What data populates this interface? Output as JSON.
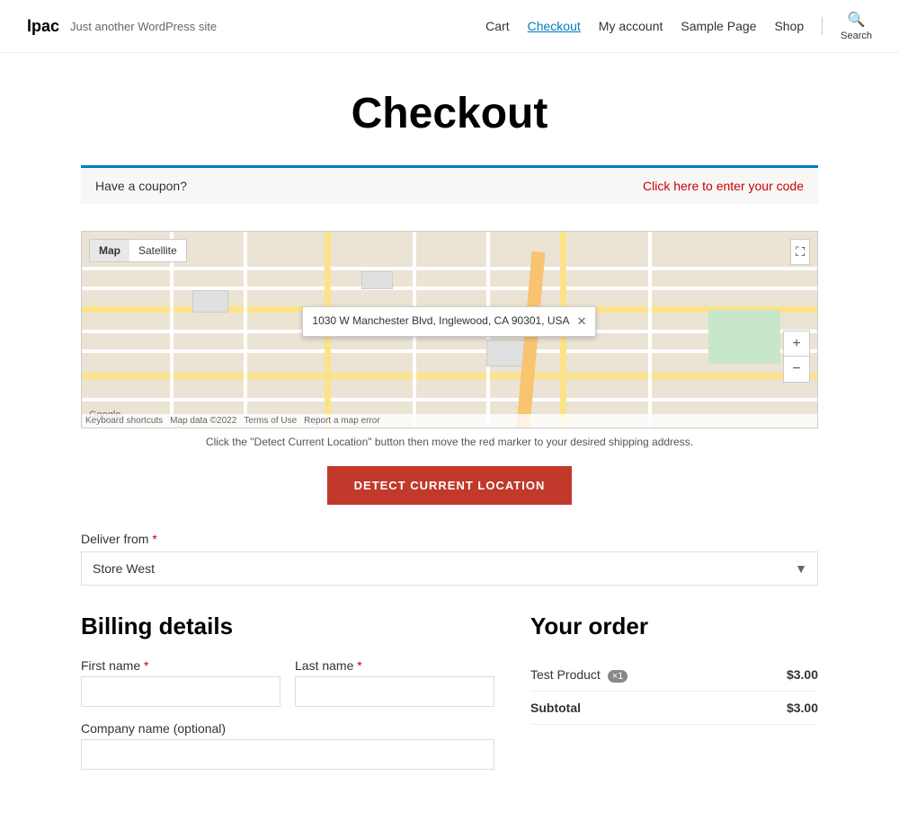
{
  "header": {
    "site_title": "lpac",
    "site_tagline": "Just another WordPress site",
    "nav": [
      {
        "label": "Cart",
        "active": false
      },
      {
        "label": "Checkout",
        "active": true
      },
      {
        "label": "My account",
        "active": false
      },
      {
        "label": "Sample Page",
        "active": false
      },
      {
        "label": "Shop",
        "active": false
      }
    ],
    "search_label": "Search"
  },
  "page": {
    "title": "Checkout"
  },
  "coupon": {
    "text": "Have a coupon?",
    "link_text": "Click here to enter your code"
  },
  "map": {
    "tabs": [
      "Map",
      "Satellite"
    ],
    "active_tab": "Map",
    "tooltip_address": "1030 W Manchester Blvd, Inglewood, CA 90301, USA",
    "hint": "Click the \"Detect Current Location\" button then move the red marker to your desired shipping address.",
    "zoom_plus": "+",
    "zoom_minus": "−",
    "footer_items": [
      "Keyboard shortcuts",
      "Map data ©2022",
      "Terms of Use",
      "Report a map error"
    ],
    "google_logo": "Google"
  },
  "detect_button": {
    "label": "DETECT CURRENT LOCATION"
  },
  "deliver_from": {
    "label": "Deliver from",
    "required": true,
    "options": [
      "Store West"
    ],
    "selected": "Store West"
  },
  "billing": {
    "title": "Billing details",
    "fields": {
      "first_name_label": "First name",
      "first_name_required": true,
      "last_name_label": "Last name",
      "last_name_required": true,
      "company_label": "Company name (optional)"
    }
  },
  "order": {
    "title": "Your order",
    "product_name": "Test Product",
    "product_qty": "×1",
    "product_price": "$3.00",
    "subtotal_label": "Subtotal",
    "subtotal_price": "$3.00"
  }
}
